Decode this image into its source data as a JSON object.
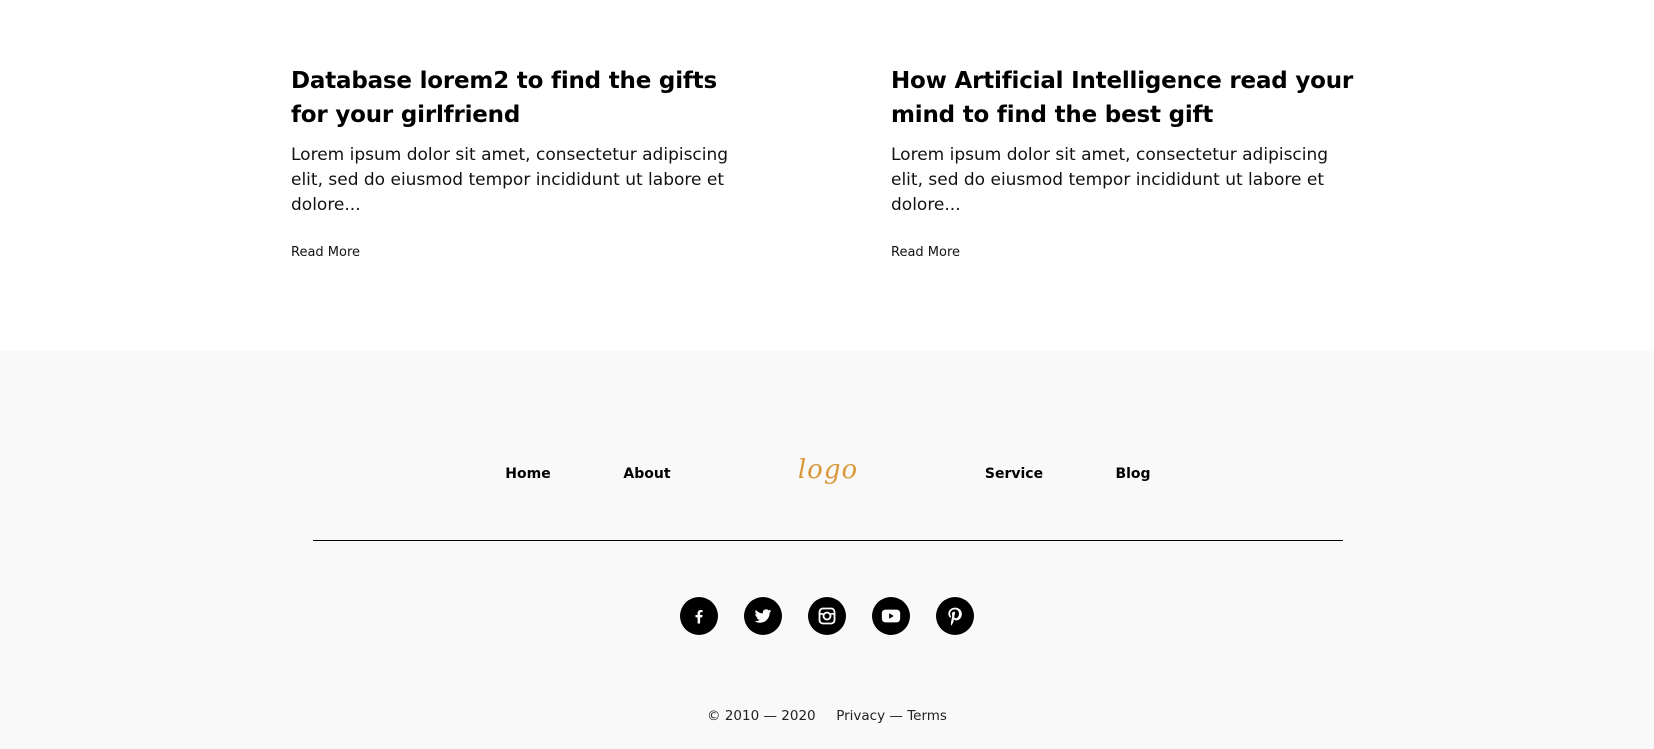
{
  "articles": [
    {
      "title": "Database lorem2 to find the gifts for your girlfriend",
      "excerpt": "Lorem ipsum dolor sit amet, consectetur adipiscing elit, sed do eiusmod tempor incididunt ut labore et dolore...",
      "read_more": "Read More"
    },
    {
      "title": "How Artificial Intelligence read your mind to find the best gift",
      "excerpt": "Lorem ipsum dolor sit amet, consectetur adipiscing elit, sed do eiusmod tempor incididunt ut labore et dolore...",
      "read_more": "Read More"
    }
  ],
  "footer": {
    "nav": {
      "home": "Home",
      "about": "About",
      "logo": "logo",
      "service": "Service",
      "blog": "Blog"
    },
    "socials": [
      "facebook-icon",
      "twitter-icon",
      "instagram-icon",
      "youtube-icon",
      "pinterest-icon"
    ],
    "copyright": "© 2010 — 2020",
    "privacy": "Privacy",
    "dash": "—",
    "terms": "Terms"
  },
  "colors": {
    "logo": "#d9993a",
    "footer_bg": "#f9f9f9"
  }
}
